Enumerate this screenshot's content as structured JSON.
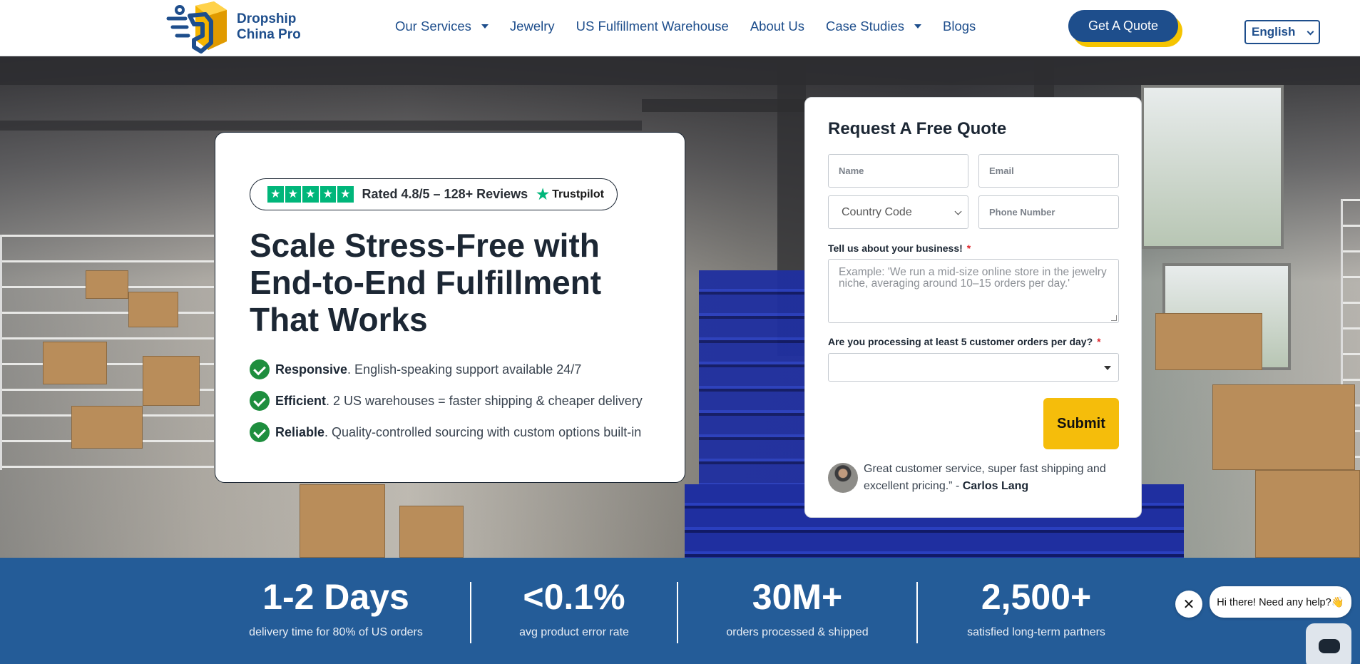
{
  "header": {
    "logo_line1": "Dropship",
    "logo_line2": "China Pro",
    "nav": [
      {
        "label": "Our Services",
        "has_dropdown": true
      },
      {
        "label": "Jewelry",
        "has_dropdown": false
      },
      {
        "label": "US Fulfillment Warehouse",
        "has_dropdown": false
      },
      {
        "label": "About Us",
        "has_dropdown": false
      },
      {
        "label": "Case Studies",
        "has_dropdown": true
      },
      {
        "label": "Blogs",
        "has_dropdown": false
      }
    ],
    "cta_label": "Get A Quote",
    "language": "English"
  },
  "hero": {
    "rating_text": "Rated 4.8/5 – 128+ Reviews",
    "rating_stars": 5,
    "trustpilot_label": "Trustpilot",
    "title": "Scale Stress-Free with End-to-End Fulfillment That Works",
    "bullets": [
      {
        "bold": "Responsive",
        "text": ". English-speaking support available 24/7"
      },
      {
        "bold": "Efficient",
        "text": ". 2 US warehouses = faster shipping & cheaper delivery"
      },
      {
        "bold": "Reliable",
        "text": ". Quality-controlled sourcing with custom options built-in"
      }
    ]
  },
  "form": {
    "title": "Request A Free Quote",
    "name_placeholder": "Name",
    "email_placeholder": "Email",
    "country_code_label": "Country Code",
    "phone_placeholder": "Phone Number",
    "business_label": "Tell us about your business!",
    "business_placeholder": "Example: 'We run a mid-size online store in the jewelry niche, averaging around 10–15 orders per day.'",
    "orders_label": "Are you processing at least 5 customer orders per day?",
    "required_mark": "*",
    "orders_value": "",
    "submit_label": "Submit",
    "testimonial_text": "Great customer service, super fast shipping and excellent pricing.” - ",
    "testimonial_author": "Carlos Lang"
  },
  "stats": [
    {
      "value": "1-2 Days",
      "label": "delivery time for 80% of US orders"
    },
    {
      "value": "<0.1%",
      "label": "avg product error rate"
    },
    {
      "value": "30M+",
      "label": "orders processed & shipped"
    },
    {
      "value": "2,500+",
      "label": "satisfied long-term partners"
    }
  ],
  "chat": {
    "greeting": "Hi there! Need any help?👋",
    "close_symbol": "✕"
  },
  "colors": {
    "brand_blue": "#1e4e8c",
    "accent_yellow": "#f5bd0b",
    "stats_band": "#245c98",
    "trustpilot_green": "#00b67a",
    "check_green": "#1e8e3e"
  }
}
